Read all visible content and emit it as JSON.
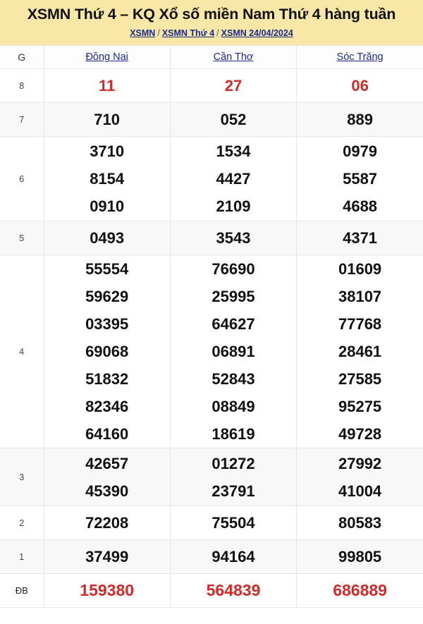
{
  "header": {
    "title": "XSMN Thứ 4 – KQ Xổ số miền Nam Thứ 4 hàng tuần",
    "breadcrumb": [
      {
        "label": "XSMN"
      },
      {
        "label": "XSMN Thứ 4"
      },
      {
        "label": "XSMN 24/04/2024"
      }
    ],
    "breadcrumb_separator": "/",
    "background_color": "#f8e7a6",
    "link_color": "#1b2a8a"
  },
  "table": {
    "columns": [
      {
        "key": "prize",
        "label": "G",
        "is_link": false
      },
      {
        "key": "dong_nai",
        "label": "Đồng Nai",
        "is_link": true
      },
      {
        "key": "can_tho",
        "label": "Cần Thơ",
        "is_link": true
      },
      {
        "key": "soc_trang",
        "label": "Sóc Trăng",
        "is_link": true
      }
    ],
    "highlight_color": "#cf2b2b",
    "rows": [
      {
        "prize": "8",
        "highlight": true,
        "dong_nai": [
          "11"
        ],
        "can_tho": [
          "27"
        ],
        "soc_trang": [
          "06"
        ]
      },
      {
        "prize": "7",
        "highlight": false,
        "dong_nai": [
          "710"
        ],
        "can_tho": [
          "052"
        ],
        "soc_trang": [
          "889"
        ]
      },
      {
        "prize": "6",
        "highlight": false,
        "dong_nai": [
          "3710",
          "8154",
          "0910"
        ],
        "can_tho": [
          "1534",
          "4427",
          "2109"
        ],
        "soc_trang": [
          "0979",
          "5587",
          "4688"
        ]
      },
      {
        "prize": "5",
        "highlight": false,
        "dong_nai": [
          "0493"
        ],
        "can_tho": [
          "3543"
        ],
        "soc_trang": [
          "4371"
        ]
      },
      {
        "prize": "4",
        "highlight": false,
        "dong_nai": [
          "55554",
          "59629",
          "03395",
          "69068",
          "51832",
          "82346",
          "64160"
        ],
        "can_tho": [
          "76690",
          "25995",
          "64627",
          "06891",
          "52843",
          "08849",
          "18619"
        ],
        "soc_trang": [
          "01609",
          "38107",
          "77768",
          "28461",
          "27585",
          "95275",
          "49728"
        ]
      },
      {
        "prize": "3",
        "highlight": false,
        "dong_nai": [
          "42657",
          "45390"
        ],
        "can_tho": [
          "01272",
          "23791"
        ],
        "soc_trang": [
          "27992",
          "41004"
        ]
      },
      {
        "prize": "2",
        "highlight": false,
        "dong_nai": [
          "72208"
        ],
        "can_tho": [
          "75504"
        ],
        "soc_trang": [
          "80583"
        ]
      },
      {
        "prize": "1",
        "highlight": false,
        "dong_nai": [
          "37499"
        ],
        "can_tho": [
          "94164"
        ],
        "soc_trang": [
          "99805"
        ]
      },
      {
        "prize": "ĐB",
        "highlight": true,
        "dong_nai": [
          "159380"
        ],
        "can_tho": [
          "564839"
        ],
        "soc_trang": [
          "686889"
        ]
      }
    ]
  }
}
